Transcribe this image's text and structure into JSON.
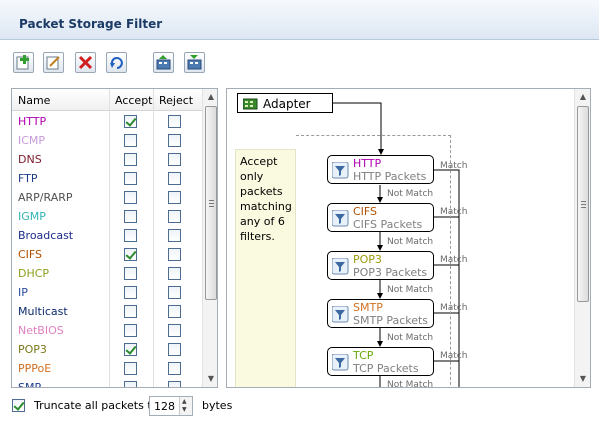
{
  "header": {
    "title": "Packet Storage Filter"
  },
  "toolbar": {
    "buttons": [
      {
        "name": "add",
        "icon": "add-filter-icon"
      },
      {
        "name": "edit",
        "icon": "edit-filter-icon"
      },
      {
        "name": "delete",
        "icon": "delete-filter-icon"
      },
      {
        "name": "refresh",
        "icon": "refresh-icon"
      },
      {
        "name": "import",
        "icon": "import-filter-icon"
      },
      {
        "name": "export",
        "icon": "export-filter-icon"
      }
    ]
  },
  "list": {
    "columns": [
      "Name",
      "Accept",
      "Reject"
    ],
    "rows": [
      {
        "name": "HTTP",
        "color": "#b000b0",
        "accept": true,
        "reject": false
      },
      {
        "name": "ICMP",
        "color": "#c89ad8",
        "accept": false,
        "reject": false
      },
      {
        "name": "DNS",
        "color": "#7a1b2b",
        "accept": false,
        "reject": false
      },
      {
        "name": "FTP",
        "color": "#1b3b8a",
        "accept": false,
        "reject": false
      },
      {
        "name": "ARP/RARP",
        "color": "#505050",
        "accept": false,
        "reject": false
      },
      {
        "name": "IGMP",
        "color": "#32b4b4",
        "accept": false,
        "reject": false
      },
      {
        "name": "Broadcast",
        "color": "#1b2b8a",
        "accept": false,
        "reject": false
      },
      {
        "name": "CIFS",
        "color": "#b05000",
        "accept": true,
        "reject": false
      },
      {
        "name": "DHCP",
        "color": "#8aa020",
        "accept": false,
        "reject": false
      },
      {
        "name": "IP",
        "color": "#2b4ba0",
        "accept": false,
        "reject": false
      },
      {
        "name": "Multicast",
        "color": "#0a2a6a",
        "accept": false,
        "reject": false
      },
      {
        "name": "NetBIOS",
        "color": "#e080c0",
        "accept": false,
        "reject": false
      },
      {
        "name": "POP3",
        "color": "#7a7a1b",
        "accept": true,
        "reject": false
      },
      {
        "name": "PPPoE",
        "color": "#d07020",
        "accept": false,
        "reject": false
      },
      {
        "name": "SMP",
        "color": "#1b3b8a",
        "accept": false,
        "reject": false
      }
    ]
  },
  "diagram": {
    "adapter_label": "Adapter",
    "note_lines": [
      "Accept",
      "only",
      "packets",
      "matching",
      "any of 6",
      "filters."
    ],
    "nodes": [
      {
        "name": "HTTP",
        "sub": "HTTP Packets",
        "color": "#b000b0"
      },
      {
        "name": "CIFS",
        "sub": "CIFS Packets",
        "color": "#b05000"
      },
      {
        "name": "POP3",
        "sub": "POP3 Packets",
        "color": "#9a9a10"
      },
      {
        "name": "SMTP",
        "sub": "SMTP Packets",
        "color": "#d07020"
      },
      {
        "name": "TCP",
        "sub": "TCP Packets",
        "color": "#6aaa10"
      }
    ],
    "match_label": "Match",
    "not_match_label": "Not Match"
  },
  "footer": {
    "truncate_checked": true,
    "truncate_label": "Truncate all packets to",
    "truncate_value": "128",
    "units": "bytes"
  }
}
